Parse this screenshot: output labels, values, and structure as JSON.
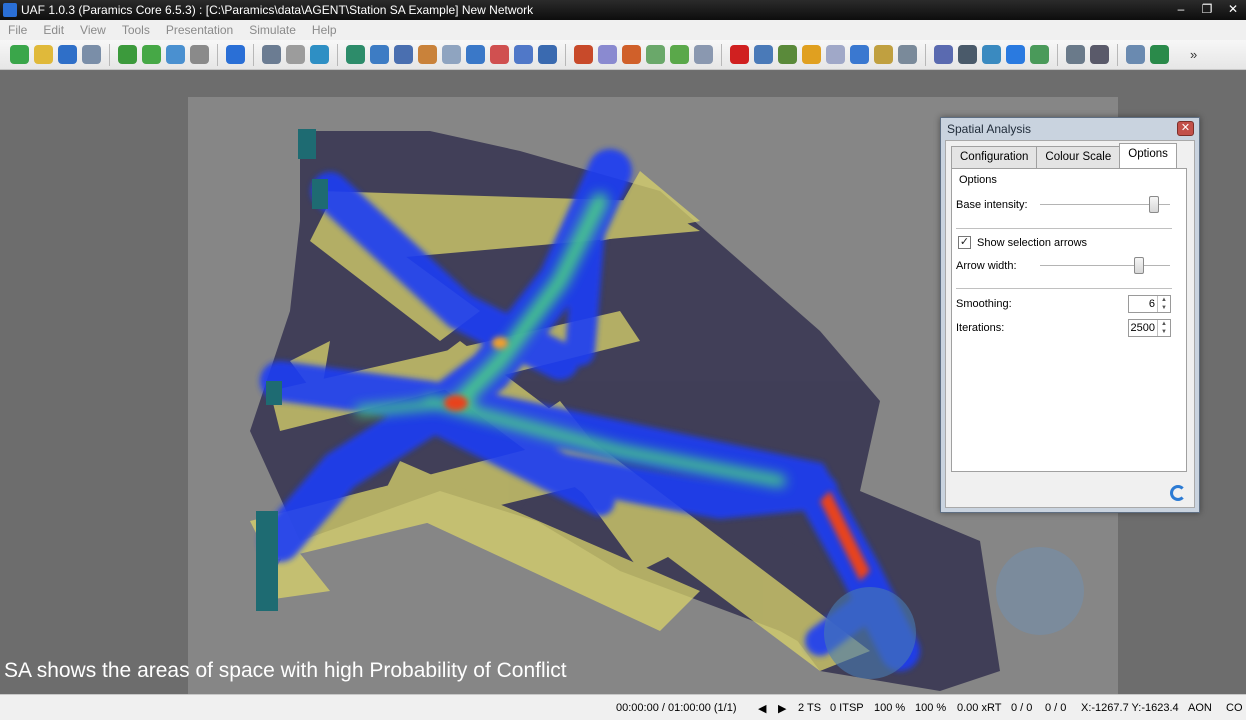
{
  "window": {
    "title": "UAF 1.0.3 (Paramics Core 6.5.3) : [C:\\Paramics\\data\\AGENT\\Station SA Example] New Network",
    "controls": {
      "minimize": "‒",
      "restore": "❐",
      "close": "✕"
    }
  },
  "menu": [
    "File",
    "Edit",
    "View",
    "Tools",
    "Presentation",
    "Simulate",
    "Help"
  ],
  "toolbar": {
    "icons": [
      "new-icon",
      "open-icon",
      "save-icon",
      "save-as-icon",
      "shield-green-icon",
      "shield-icon",
      "check-icon",
      "shield-grey-icon",
      "cube-icon",
      "layers-icon",
      "transform-icon",
      "globe-icon",
      "arrow-icon",
      "route-icon",
      "pedestrian-icon",
      "agents-icon",
      "panel-icon",
      "node-icon",
      "grid-icon",
      "calendar-icon",
      "checklist-icon",
      "zone-icon",
      "zoom-icon",
      "pin-icon",
      "link-icon",
      "flag-icon",
      "doc-icon",
      "record-icon",
      "vehicle-icon",
      "people-icon",
      "bulb-icon",
      "table-icon",
      "group-icon",
      "person-icon",
      "list-icon",
      "edit-icon",
      "matrix-icon",
      "chart-icon",
      "earth-icon",
      "image-icon",
      "settings-icon",
      "gear-icon",
      "network-icon",
      "globe-nav-icon"
    ],
    "more_label": "»"
  },
  "caption": "SA shows the areas of space with high Probability of Conflict",
  "spatial_analysis": {
    "title": "Spatial Analysis",
    "close": "✕",
    "tabs": [
      "Configuration",
      "Colour Scale",
      "Options"
    ],
    "active_tab": "Options",
    "group_label": "Options",
    "base_intensity_label": "Base intensity:",
    "base_intensity_value": 0.88,
    "show_arrows_label": "Show selection arrows",
    "show_arrows_checked": "✓",
    "arrow_width_label": "Arrow width:",
    "arrow_width_value": 0.76,
    "smoothing_label": "Smoothing:",
    "smoothing_value": "6",
    "iterations_label": "Iterations:",
    "iterations_value": "2500"
  },
  "status": {
    "time": "00:00:00 / 01:00:00 (1/1)",
    "prev": "◀",
    "next": "▶",
    "ts": "2 TS",
    "itsp": "0 ITSP",
    "pct1": "100 %",
    "pct2": "100 %",
    "xrt": "0.00 xRT",
    "r1": "0 / 0",
    "r2": "0 / 0",
    "coords": "X:-1267.7  Y:-1623.4",
    "aon": "AON",
    "co": "CO"
  },
  "colors": {
    "heat_blue": "#1a3cff",
    "heat_green": "#3fe07a",
    "heat_red": "#e33a1a",
    "arrow_yellow": "#d9d36a",
    "building": "#3c3a52"
  }
}
